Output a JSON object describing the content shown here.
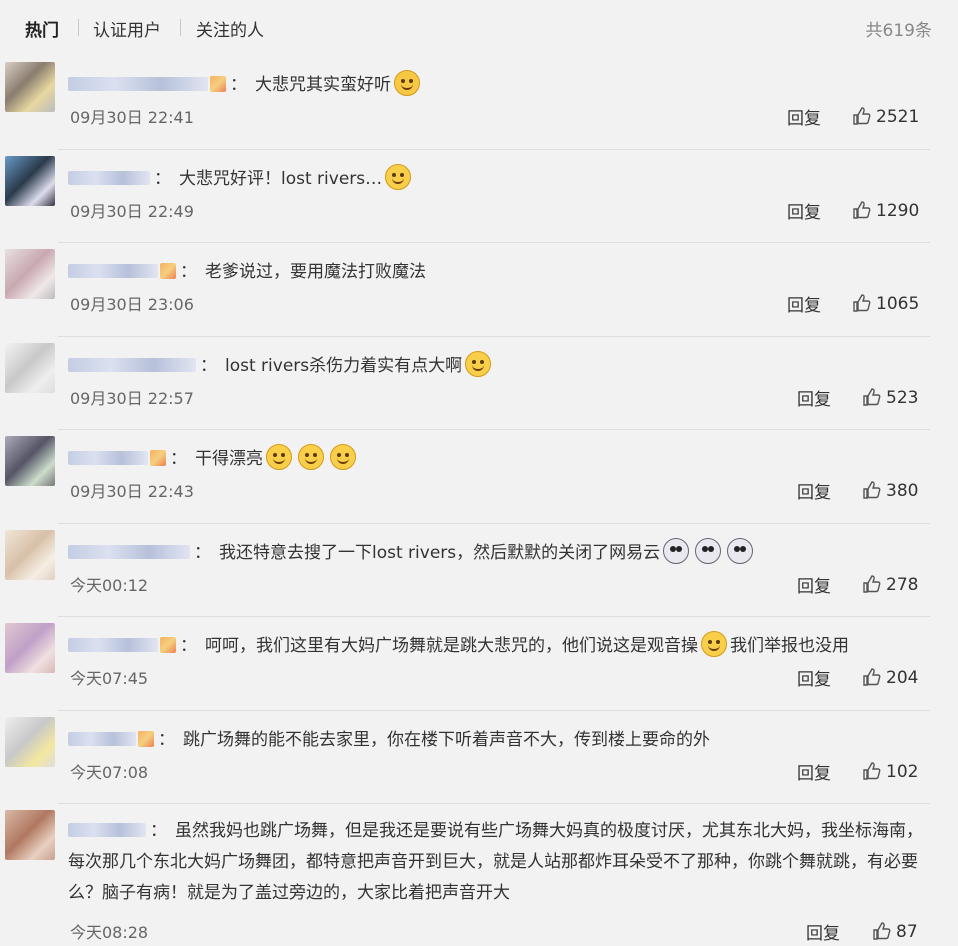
{
  "tabs": [
    {
      "label": "热门"
    },
    {
      "label": "认证用户"
    },
    {
      "label": "关注的人"
    }
  ],
  "total": "共619条",
  "reply_label": "回复",
  "comments": [
    {
      "text": "大悲咒其实蛮好听",
      "time": "09月30日 22:41",
      "likes": "2521",
      "emoji": [
        "grin"
      ]
    },
    {
      "text": "大悲咒好评！lost rivers…",
      "time": "09月30日 22:49",
      "likes": "1290",
      "emoji": [
        "laugh"
      ]
    },
    {
      "text": "老爹说过，要用魔法打败魔法",
      "time": "09月30日 23:06",
      "likes": "1065",
      "emoji": []
    },
    {
      "text": "lost rivers杀伤力着实有点大啊",
      "time": "09月30日 22:57",
      "likes": "523",
      "emoji": [
        "laugh"
      ]
    },
    {
      "text": "干得漂亮",
      "time": "09月30日 22:43",
      "likes": "380",
      "emoji": [
        "smile",
        "smile",
        "smile"
      ]
    },
    {
      "text": "我还特意去搜了一下lost rivers，然后默默的关闭了网易云",
      "time": "今天00:12",
      "likes": "278",
      "emoji": [
        "dog",
        "dog",
        "dog"
      ]
    },
    {
      "text": "呵呵，我们这里有大妈广场舞就是跳大悲咒的，他们说这是观音操",
      "text2": "我们举报也没用",
      "time": "今天07:45",
      "likes": "204",
      "emoji": [
        "cry"
      ]
    },
    {
      "text": "跳广场舞的能不能去家里，你在楼下听着声音不大，传到楼上要命的外",
      "time": "今天07:08",
      "likes": "102",
      "emoji": []
    },
    {
      "text": "虽然我妈也跳广场舞，但是我还是要说有些广场舞大妈真的极度讨厌，尤其东北大妈，我坐标海南，每次那几个东北大妈广场舞团，都特意把声音开到巨大，就是人站那都炸耳朵受不了那种，你跳个舞就跳，有必要么？脑子有病！就是为了盖过旁边的，大家比着把声音开大",
      "time": "今天08:28",
      "likes": "87",
      "emoji": []
    }
  ],
  "colors": {
    "background": "#f2f2f2",
    "text": "#333333",
    "muted": "#888888"
  }
}
